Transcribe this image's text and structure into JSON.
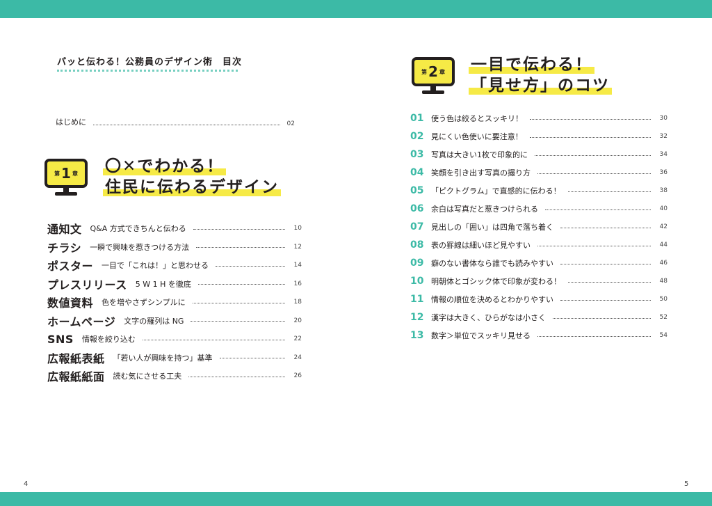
{
  "toc_title": "パッと伝わる！公務員のデザイン術　目次",
  "intro": {
    "label": "はじめに",
    "page": "02"
  },
  "chapter1": {
    "kanji_top": "第",
    "number": "1",
    "kanji_bottom": "章",
    "heading_line1": "〇✕でわかる！",
    "heading_line2": "住民に伝わるデザイン",
    "items": [
      {
        "topic": "通知文",
        "desc": "Q&A 方式できちんと伝わる",
        "page": "10"
      },
      {
        "topic": "チラシ",
        "desc": "一瞬で興味を惹きつける方法",
        "page": "12"
      },
      {
        "topic": "ポスター",
        "desc": "一目で「これは！」と思わせる",
        "page": "14"
      },
      {
        "topic": "プレスリリース",
        "desc": "5 W 1 H を徹底",
        "page": "16"
      },
      {
        "topic": "数値資料",
        "desc": "色を増やさずシンプルに",
        "page": "18"
      },
      {
        "topic": "ホームページ",
        "desc": "文字の羅列は NG",
        "page": "20"
      },
      {
        "topic": "SNS",
        "desc": "情報を絞り込む",
        "page": "22"
      },
      {
        "topic": "広報紙表紙",
        "desc": "「若い人が興味を持つ」基準",
        "page": "24"
      },
      {
        "topic": "広報紙紙面",
        "desc": "読む気にさせる工夫",
        "page": "26"
      }
    ]
  },
  "chapter2": {
    "kanji_top": "第",
    "number": "2",
    "kanji_bottom": "章",
    "heading_line1": "一目で伝わる！",
    "heading_line2": "「見せ方」のコツ",
    "items": [
      {
        "idx": "01",
        "text": "使う色は絞るとスッキリ！",
        "page": "30"
      },
      {
        "idx": "02",
        "text": "見にくい色使いに要注意！",
        "page": "32"
      },
      {
        "idx": "03",
        "text": "写真は大きい1枚で印象的に",
        "page": "34"
      },
      {
        "idx": "04",
        "text": "笑顔を引き出す写真の撮り方",
        "page": "36"
      },
      {
        "idx": "05",
        "text": "「ピクトグラム」で直感的に伝わる！",
        "page": "38"
      },
      {
        "idx": "06",
        "text": "余白は写真だと惹きつけられる",
        "page": "40"
      },
      {
        "idx": "07",
        "text": "見出しの「囲い」は四角で落ち着く",
        "page": "42"
      },
      {
        "idx": "08",
        "text": "表の罫線は細いほど見やすい",
        "page": "44"
      },
      {
        "idx": "09",
        "text": "癖のない書体なら誰でも読みやすい",
        "page": "46"
      },
      {
        "idx": "10",
        "text": "明朝体とゴシック体で印象が変わる！",
        "page": "48"
      },
      {
        "idx": "11",
        "text": "情報の順位を決めるとわかりやすい",
        "page": "50"
      },
      {
        "idx": "12",
        "text": "漢字は大きく、ひらがなは小さく",
        "page": "52"
      },
      {
        "idx": "13",
        "text": "数字＞単位でスッキリ見せる",
        "page": "54"
      }
    ]
  },
  "page_left": "4",
  "page_right": "5",
  "colors": {
    "accent": "#3cbaa6",
    "highlight": "#f6ea46",
    "ink": "#231f1f"
  }
}
